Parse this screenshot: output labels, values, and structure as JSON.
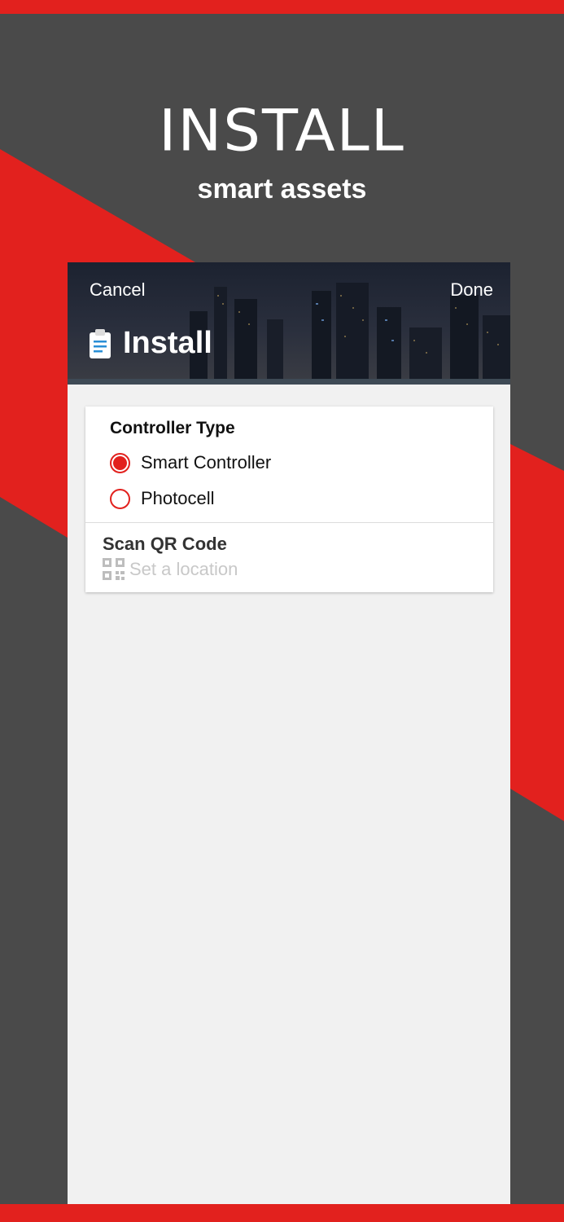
{
  "hero": {
    "title": "INSTALL",
    "subtitle": "smart assets"
  },
  "colors": {
    "accent": "#e2211e",
    "background": "#4a4a4a",
    "panel": "#f1f1f1"
  },
  "nav": {
    "cancel_label": "Cancel",
    "done_label": "Done",
    "title": "Install",
    "title_icon": "clipboard-icon"
  },
  "form": {
    "controller_type": {
      "title": "Controller Type",
      "options": [
        {
          "label": "Smart Controller",
          "selected": true
        },
        {
          "label": "Photocell",
          "selected": false
        }
      ]
    },
    "scan_qr": {
      "title": "Scan QR Code",
      "placeholder": "Set a location",
      "icon": "qr-code-icon"
    }
  }
}
